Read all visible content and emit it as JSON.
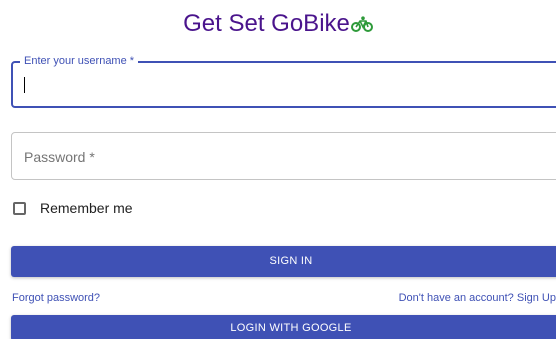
{
  "header": {
    "title": "Get Set GoBike"
  },
  "form": {
    "username_label": "Enter your username *",
    "username_value": "",
    "password_placeholder": "Password *",
    "remember_label": "Remember me",
    "remember_checked": false,
    "signin_label": "SIGN IN",
    "forgot_link": "Forgot password?",
    "signup_link": "Don't have an account? Sign Up",
    "google_label": "LOGIN WITH GOOGLE"
  },
  "icons": {
    "title_icon": "bicycle-icon"
  },
  "colors": {
    "title": "#4a148c",
    "primary": "#3f51b5",
    "bike_icon": "#2e9a3a"
  }
}
